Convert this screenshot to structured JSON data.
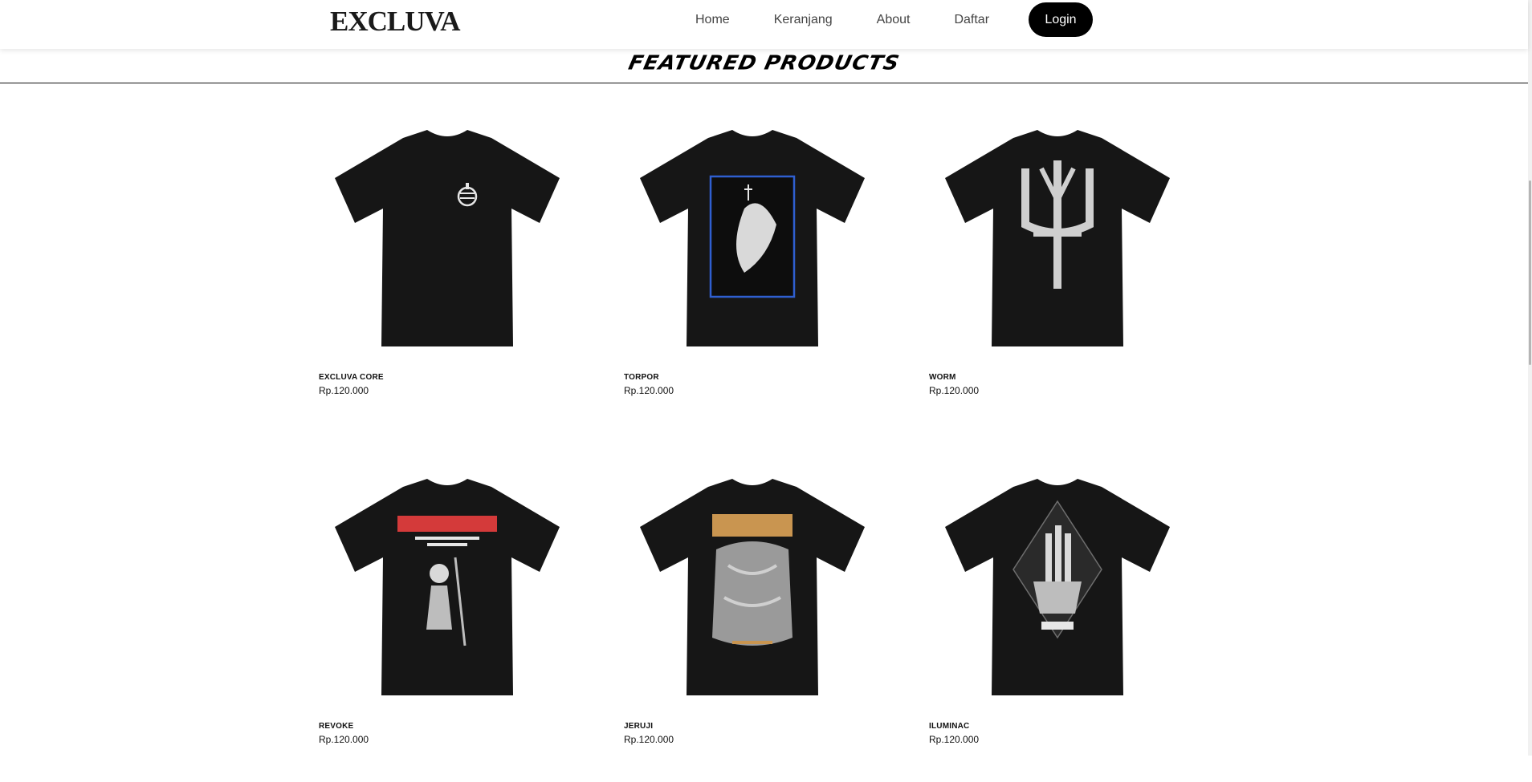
{
  "navbar": {
    "brand": "EXCLUVA",
    "links": [
      "Home",
      "Keranjang",
      "About",
      "Daftar"
    ],
    "login_label": "Login"
  },
  "section": {
    "title": "FEATURED PRODUCTS"
  },
  "products": [
    {
      "name": "EXCLUVA CORE",
      "price": "Rp.120.000",
      "graphic": "small-chest-logo"
    },
    {
      "name": "TORPOR",
      "price": "Rp.120.000",
      "graphic": "framed-figure-blue"
    },
    {
      "name": "WORM",
      "price": "Rp.120.000",
      "graphic": "large-white-symbol"
    },
    {
      "name": "REVOKE",
      "price": "Rp.120.000",
      "graphic": "red-lettering-skeleton"
    },
    {
      "name": "JERUJI",
      "price": "Rp.120.000",
      "graphic": "gold-lettering-figures"
    },
    {
      "name": "ILUMINAC",
      "price": "Rp.120.000",
      "graphic": "diamond-candles"
    }
  ],
  "colors": {
    "shirt": "#161616",
    "accent_blue": "#2f5fd0",
    "accent_red": "#d43a3a",
    "accent_gold": "#c99550",
    "button_bg": "#000000"
  }
}
